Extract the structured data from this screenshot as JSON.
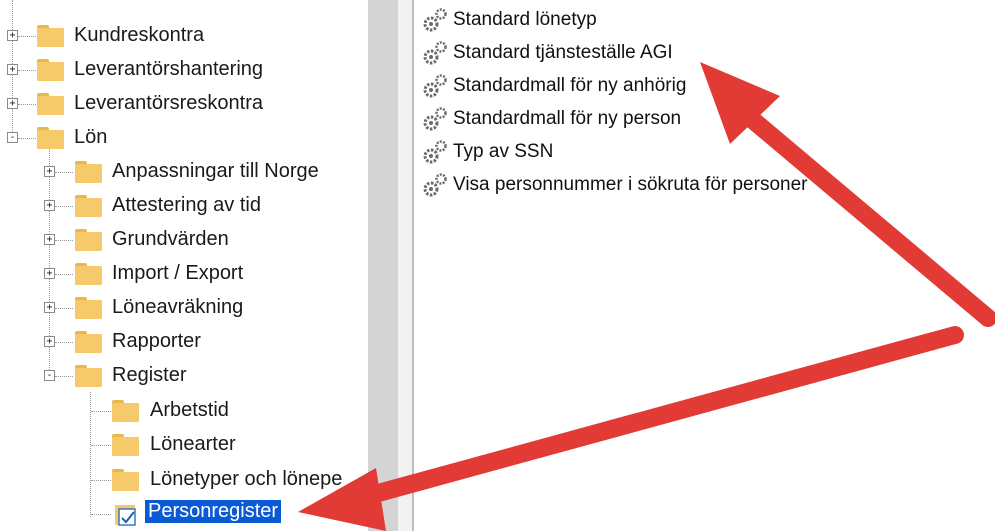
{
  "tree": {
    "top_nodes": [
      {
        "label": "Kundreskontra",
        "expander": "+"
      },
      {
        "label": "Leverantörshantering",
        "expander": "+"
      },
      {
        "label": "Leverantörsreskontra",
        "expander": "+"
      },
      {
        "label": "Lön",
        "expander": "-"
      }
    ],
    "lon_children": [
      {
        "label": "Anpassningar till Norge",
        "expander": "+"
      },
      {
        "label": "Attestering av tid",
        "expander": "+"
      },
      {
        "label": "Grundvärden",
        "expander": "+"
      },
      {
        "label": "Import / Export",
        "expander": "+"
      },
      {
        "label": "Löneavräkning",
        "expander": "+"
      },
      {
        "label": "Rapporter",
        "expander": "+"
      },
      {
        "label": "Register",
        "expander": "-"
      }
    ],
    "register_children": [
      {
        "label": "Arbetstid"
      },
      {
        "label": "Lönearter"
      },
      {
        "label": "Lönetyper och lönepe"
      },
      {
        "label": "Personregister",
        "selected": true
      }
    ]
  },
  "settings_list": [
    "Standard lönetyp",
    "Standard tjänsteställe AGI",
    "Standardmall för ny anhörig",
    "Standardmall för ny person",
    "Typ av SSN",
    "Visa personnummer i sökruta för personer"
  ],
  "colors": {
    "selection": "#0a5ad6",
    "folder": "#f6c96a",
    "arrow": "#e23a35"
  }
}
